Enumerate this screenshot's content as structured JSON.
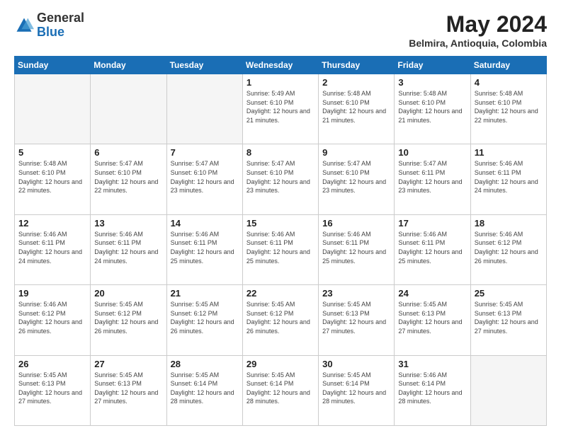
{
  "header": {
    "logo": {
      "general": "General",
      "blue": "Blue"
    },
    "title": "May 2024",
    "location": "Belmira, Antioquia, Colombia"
  },
  "weekdays": [
    "Sunday",
    "Monday",
    "Tuesday",
    "Wednesday",
    "Thursday",
    "Friday",
    "Saturday"
  ],
  "weeks": [
    [
      {
        "day": "",
        "info": ""
      },
      {
        "day": "",
        "info": ""
      },
      {
        "day": "",
        "info": ""
      },
      {
        "day": "1",
        "info": "Sunrise: 5:49 AM\nSunset: 6:10 PM\nDaylight: 12 hours and 21 minutes."
      },
      {
        "day": "2",
        "info": "Sunrise: 5:48 AM\nSunset: 6:10 PM\nDaylight: 12 hours and 21 minutes."
      },
      {
        "day": "3",
        "info": "Sunrise: 5:48 AM\nSunset: 6:10 PM\nDaylight: 12 hours and 21 minutes."
      },
      {
        "day": "4",
        "info": "Sunrise: 5:48 AM\nSunset: 6:10 PM\nDaylight: 12 hours and 22 minutes."
      }
    ],
    [
      {
        "day": "5",
        "info": "Sunrise: 5:48 AM\nSunset: 6:10 PM\nDaylight: 12 hours and 22 minutes."
      },
      {
        "day": "6",
        "info": "Sunrise: 5:47 AM\nSunset: 6:10 PM\nDaylight: 12 hours and 22 minutes."
      },
      {
        "day": "7",
        "info": "Sunrise: 5:47 AM\nSunset: 6:10 PM\nDaylight: 12 hours and 23 minutes."
      },
      {
        "day": "8",
        "info": "Sunrise: 5:47 AM\nSunset: 6:10 PM\nDaylight: 12 hours and 23 minutes."
      },
      {
        "day": "9",
        "info": "Sunrise: 5:47 AM\nSunset: 6:10 PM\nDaylight: 12 hours and 23 minutes."
      },
      {
        "day": "10",
        "info": "Sunrise: 5:47 AM\nSunset: 6:11 PM\nDaylight: 12 hours and 23 minutes."
      },
      {
        "day": "11",
        "info": "Sunrise: 5:46 AM\nSunset: 6:11 PM\nDaylight: 12 hours and 24 minutes."
      }
    ],
    [
      {
        "day": "12",
        "info": "Sunrise: 5:46 AM\nSunset: 6:11 PM\nDaylight: 12 hours and 24 minutes."
      },
      {
        "day": "13",
        "info": "Sunrise: 5:46 AM\nSunset: 6:11 PM\nDaylight: 12 hours and 24 minutes."
      },
      {
        "day": "14",
        "info": "Sunrise: 5:46 AM\nSunset: 6:11 PM\nDaylight: 12 hours and 25 minutes."
      },
      {
        "day": "15",
        "info": "Sunrise: 5:46 AM\nSunset: 6:11 PM\nDaylight: 12 hours and 25 minutes."
      },
      {
        "day": "16",
        "info": "Sunrise: 5:46 AM\nSunset: 6:11 PM\nDaylight: 12 hours and 25 minutes."
      },
      {
        "day": "17",
        "info": "Sunrise: 5:46 AM\nSunset: 6:11 PM\nDaylight: 12 hours and 25 minutes."
      },
      {
        "day": "18",
        "info": "Sunrise: 5:46 AM\nSunset: 6:12 PM\nDaylight: 12 hours and 26 minutes."
      }
    ],
    [
      {
        "day": "19",
        "info": "Sunrise: 5:46 AM\nSunset: 6:12 PM\nDaylight: 12 hours and 26 minutes."
      },
      {
        "day": "20",
        "info": "Sunrise: 5:45 AM\nSunset: 6:12 PM\nDaylight: 12 hours and 26 minutes."
      },
      {
        "day": "21",
        "info": "Sunrise: 5:45 AM\nSunset: 6:12 PM\nDaylight: 12 hours and 26 minutes."
      },
      {
        "day": "22",
        "info": "Sunrise: 5:45 AM\nSunset: 6:12 PM\nDaylight: 12 hours and 26 minutes."
      },
      {
        "day": "23",
        "info": "Sunrise: 5:45 AM\nSunset: 6:13 PM\nDaylight: 12 hours and 27 minutes."
      },
      {
        "day": "24",
        "info": "Sunrise: 5:45 AM\nSunset: 6:13 PM\nDaylight: 12 hours and 27 minutes."
      },
      {
        "day": "25",
        "info": "Sunrise: 5:45 AM\nSunset: 6:13 PM\nDaylight: 12 hours and 27 minutes."
      }
    ],
    [
      {
        "day": "26",
        "info": "Sunrise: 5:45 AM\nSunset: 6:13 PM\nDaylight: 12 hours and 27 minutes."
      },
      {
        "day": "27",
        "info": "Sunrise: 5:45 AM\nSunset: 6:13 PM\nDaylight: 12 hours and 27 minutes."
      },
      {
        "day": "28",
        "info": "Sunrise: 5:45 AM\nSunset: 6:14 PM\nDaylight: 12 hours and 28 minutes."
      },
      {
        "day": "29",
        "info": "Sunrise: 5:45 AM\nSunset: 6:14 PM\nDaylight: 12 hours and 28 minutes."
      },
      {
        "day": "30",
        "info": "Sunrise: 5:45 AM\nSunset: 6:14 PM\nDaylight: 12 hours and 28 minutes."
      },
      {
        "day": "31",
        "info": "Sunrise: 5:46 AM\nSunset: 6:14 PM\nDaylight: 12 hours and 28 minutes."
      },
      {
        "day": "",
        "info": ""
      }
    ]
  ]
}
